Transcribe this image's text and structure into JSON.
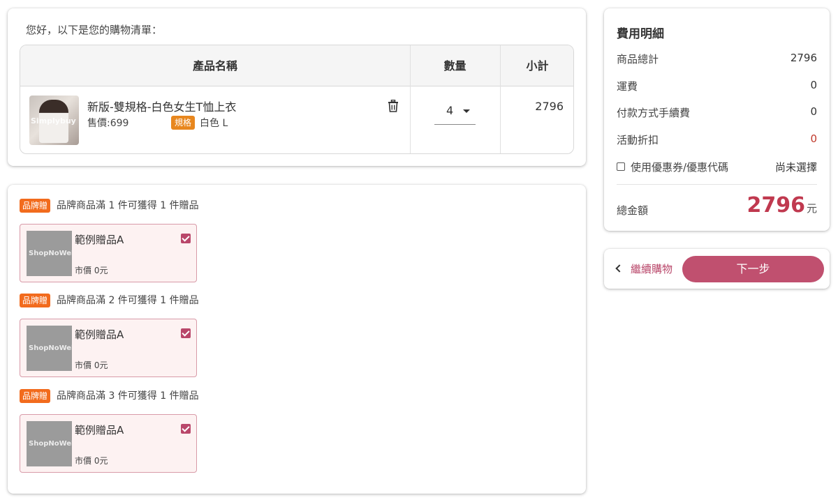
{
  "cart": {
    "greeting": "您好，以下是您的購物清單：",
    "columns": {
      "name": "產品名稱",
      "qty": "數量",
      "subtotal": "小計"
    },
    "item": {
      "image_watermark": "Simplybuy",
      "name": "新版-雙規格-白色女生T恤上衣",
      "price": "售價:699",
      "spec_badge": "規格",
      "spec_value": "白色 L",
      "quantity": "4",
      "subtotal": "2796"
    }
  },
  "gifts": {
    "badge": "品牌贈",
    "groups": [
      {
        "rule": "品牌商品滿 1 件可獲得 1 件贈品",
        "gift_name": "範例贈品A",
        "market_price": "市價 0元",
        "image_watermark": "ShopNoWeb",
        "checked": true
      },
      {
        "rule": "品牌商品滿 2 件可獲得 1 件贈品",
        "gift_name": "範例贈品A",
        "market_price": "市價 0元",
        "image_watermark": "ShopNoWeb",
        "checked": true
      },
      {
        "rule": "品牌商品滿 3 件可獲得 1 件贈品",
        "gift_name": "範例贈品A",
        "market_price": "市價 0元",
        "image_watermark": "ShopNoWeb",
        "checked": true
      }
    ]
  },
  "summary": {
    "title": "費用明細",
    "rows": [
      {
        "label": "商品總計",
        "value": "2796"
      },
      {
        "label": "運費",
        "value": "0"
      },
      {
        "label": "付款方式手續費",
        "value": "0"
      },
      {
        "label": "活動折扣",
        "value": "0"
      }
    ],
    "coupon_label": "使用優惠券/優惠代碼",
    "coupon_status": "尚未選擇",
    "total_label": "總金額",
    "total_value": "2796",
    "total_unit": "元"
  },
  "actions": {
    "back_label": "繼續購物",
    "next_label": "下一步"
  },
  "colors": {
    "accent": "#c0506f",
    "discount_red": "#c0392b",
    "gift_badge": "#f26b1d",
    "spec_badge": "#e8871e"
  }
}
